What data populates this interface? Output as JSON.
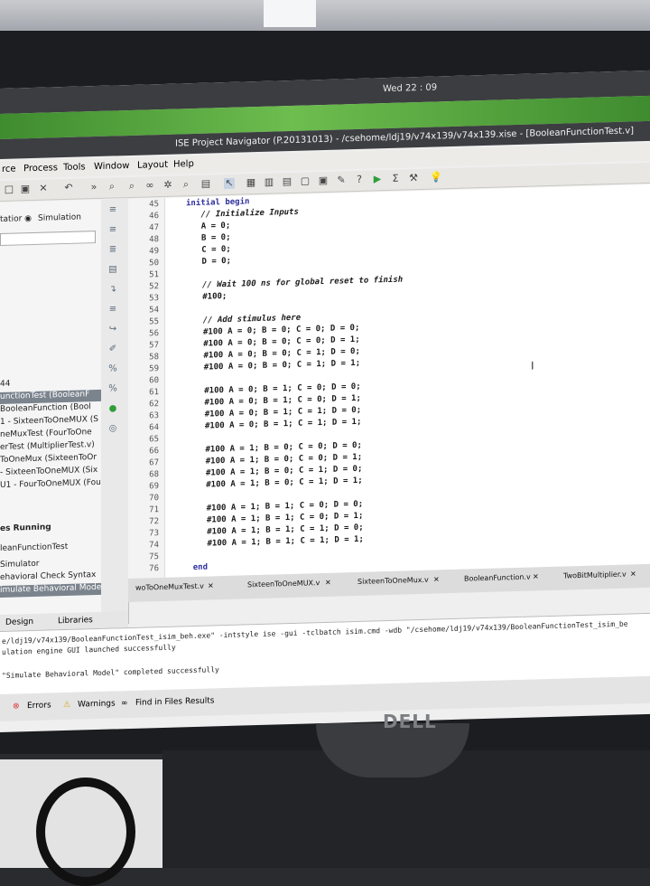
{
  "system": {
    "clock": "Wed 22 : 09"
  },
  "window": {
    "title": "ISE Project Navigator (P.20131013) - /csehome/ldj19/v74x139/v74x139.xise - [BooleanFunctionTest.v]"
  },
  "menu": [
    "rce",
    "Process",
    "Tools",
    "Window",
    "Layout",
    "Help"
  ],
  "left_panel": {
    "view_label": "tatior",
    "simulation_label": "Simulation",
    "items": [
      "44",
      "unctionTest (BooleanF",
      "BooleanFunction (Bool",
      "1 - SixteenToOneMUX (S",
      "neMuxTest (FourToOne",
      "erTest (MultiplierTest.v)",
      "ToOneMux (SixteenToOr",
      "- SixteenToOneMUX (Six",
      "U1 - FourToOneMUX (Fou"
    ],
    "processes_header": "es Running",
    "process_items": [
      "leanFunctionTest",
      "Simulator",
      "ehavioral Check Syntax",
      "imulate Behavioral Model"
    ],
    "design_tab": "Design",
    "libraries_tab": "Libraries"
  },
  "editor": {
    "lines": [
      {
        "n": "45",
        "text": "initial begin"
      },
      {
        "n": "46",
        "text": "   // Initialize Inputs"
      },
      {
        "n": "47",
        "text": "   A = 0;"
      },
      {
        "n": "48",
        "text": "   B = 0;"
      },
      {
        "n": "49",
        "text": "   C = 0;"
      },
      {
        "n": "50",
        "text": "   D = 0;"
      },
      {
        "n": "51",
        "text": ""
      },
      {
        "n": "52",
        "text": "   // Wait 100 ns for global reset to finish"
      },
      {
        "n": "53",
        "text": "   #100;"
      },
      {
        "n": "54",
        "text": ""
      },
      {
        "n": "55",
        "text": "   // Add stimulus here"
      },
      {
        "n": "56",
        "text": "   #100 A = 0; B = 0; C = 0; D = 0;"
      },
      {
        "n": "57",
        "text": "   #100 A = 0; B = 0; C = 0; D = 1;"
      },
      {
        "n": "58",
        "text": "   #100 A = 0; B = 0; C = 1; D = 0;"
      },
      {
        "n": "59",
        "text": "   #100 A = 0; B = 0; C = 1; D = 1;"
      },
      {
        "n": "60",
        "text": ""
      },
      {
        "n": "61",
        "text": "   #100 A = 0; B = 1; C = 0; D = 0;"
      },
      {
        "n": "62",
        "text": "   #100 A = 0; B = 1; C = 0; D = 1;"
      },
      {
        "n": "63",
        "text": "   #100 A = 0; B = 1; C = 1; D = 0;"
      },
      {
        "n": "64",
        "text": "   #100 A = 0; B = 1; C = 1; D = 1;"
      },
      {
        "n": "65",
        "text": ""
      },
      {
        "n": "66",
        "text": "   #100 A = 1; B = 0; C = 0; D = 0;"
      },
      {
        "n": "67",
        "text": "   #100 A = 1; B = 0; C = 0; D = 1;"
      },
      {
        "n": "68",
        "text": "   #100 A = 1; B = 0; C = 1; D = 0;"
      },
      {
        "n": "69",
        "text": "   #100 A = 1; B = 0; C = 1; D = 1;"
      },
      {
        "n": "70",
        "text": ""
      },
      {
        "n": "71",
        "text": "   #100 A = 1; B = 1; C = 0; D = 0;"
      },
      {
        "n": "72",
        "text": "   #100 A = 1; B = 1; C = 0; D = 1;"
      },
      {
        "n": "73",
        "text": "   #100 A = 1; B = 1; C = 1; D = 0;"
      },
      {
        "n": "74",
        "text": "   #100 A = 1; B = 1; C = 1; D = 1;"
      },
      {
        "n": "75",
        "text": ""
      },
      {
        "n": "76",
        "text": "end"
      }
    ]
  },
  "file_tabs": [
    "woToOneMuxTest.v",
    "SixteenToOneMUX.v",
    "SixteenToOneMux.v",
    "BooleanFunction.v",
    "TwoBitMultiplier.v"
  ],
  "console": {
    "lines": [
      "e/ldj19/v74x139/BooleanFunctionTest_isim_beh.exe\" -intstyle ise -gui -tclbatch isim.cmd  -wdb \"/csehome/ldj19/v74x139/BooleanFunctionTest_isim_be",
      "ulation engine GUI launched successfully",
      "",
      "\"Simulate Behavioral Model\" completed successfully"
    ]
  },
  "bottom_tabs": {
    "errors": "Errors",
    "warnings": "Warnings",
    "find": "Find in Files Results"
  },
  "monitor": {
    "brand": "DELL"
  }
}
